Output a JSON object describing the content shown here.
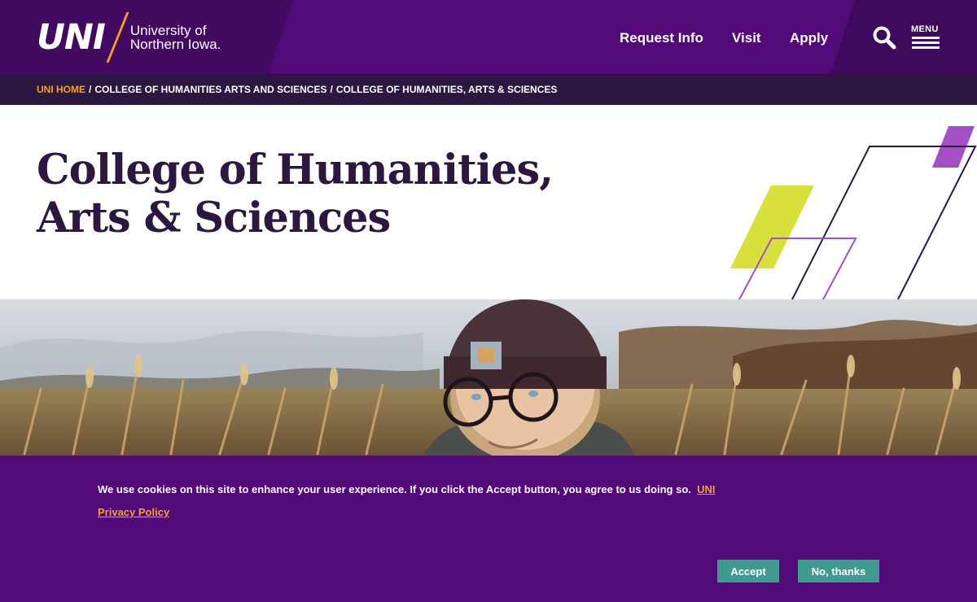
{
  "header": {
    "logo_mark": "UNI",
    "logo_line1": "University of",
    "logo_line2": "Northern Iowa.",
    "nav": [
      "Request Info",
      "Visit",
      "Apply"
    ],
    "menu_label": "MENU",
    "colors": {
      "primary": "#4b0a6e",
      "accent": "#f6a31b"
    }
  },
  "breadcrumb": {
    "items": [
      "UNI HOME",
      "COLLEGE OF HUMANITIES ARTS AND SCIENCES",
      "COLLEGE OF HUMANITIES, ARTS & SCIENCES"
    ],
    "separator": "/"
  },
  "page": {
    "title_line1": "College of Humanities,",
    "title_line2": "Arts & Sciences"
  },
  "cookie": {
    "text": "We use cookies on this site to enhance your user experience. If you click the Accept button, you agree to us doing so.",
    "link_part1": "UNI",
    "link_part2": "Privacy Policy",
    "accept_label": "Accept",
    "decline_label": "No, thanks",
    "button_color": "#3f9a90"
  }
}
